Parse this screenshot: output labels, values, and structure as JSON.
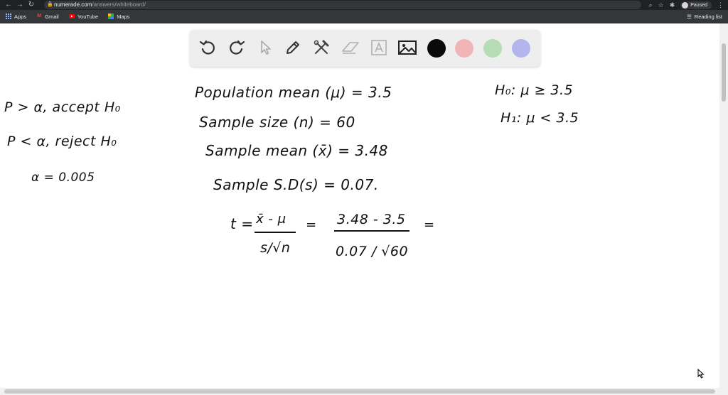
{
  "browser": {
    "url_host": "numerade.com",
    "url_path": "/answers/whiteboard/",
    "profile_label": "Paused",
    "bookmarks": [
      {
        "label": "Apps",
        "icon": "apps-grid-icon"
      },
      {
        "label": "Gmail",
        "icon": "gmail-icon"
      },
      {
        "label": "YouTube",
        "icon": "youtube-icon"
      },
      {
        "label": "Maps",
        "icon": "maps-icon"
      }
    ],
    "reading_list_label": "Reading list"
  },
  "toolbar": {
    "tools": [
      "undo-icon",
      "redo-icon",
      "select-pointer-icon",
      "pen-icon",
      "tools-icon",
      "eraser-icon",
      "text-icon",
      "image-icon"
    ],
    "colors": [
      "#0a0a0a",
      "#f2b5b5",
      "#b5dcb5",
      "#b5b5ee"
    ]
  },
  "whiteboard": {
    "left_notes": {
      "line1": "P > α, accept H₀",
      "line2": "P < α, reject H₀",
      "line3": "α = 0.005"
    },
    "given": {
      "population_mean": "Population mean (μ) = 3.5",
      "sample_size": "Sample size (n) = 60",
      "sample_mean": "Sample mean (x̄) = 3.48",
      "sample_sd": "Sample S.D(s) = 0.07."
    },
    "hypotheses": {
      "h0": "H₀: μ ≥ 3.5",
      "h1": "H₁: μ < 3.5"
    },
    "formula": {
      "t_eq": "t =",
      "num1": "x̄ - μ",
      "den1": "s/√n",
      "approx": "=",
      "num2": "3.48 - 3.5",
      "den2": "0.07 / √60",
      "tail": "="
    }
  }
}
